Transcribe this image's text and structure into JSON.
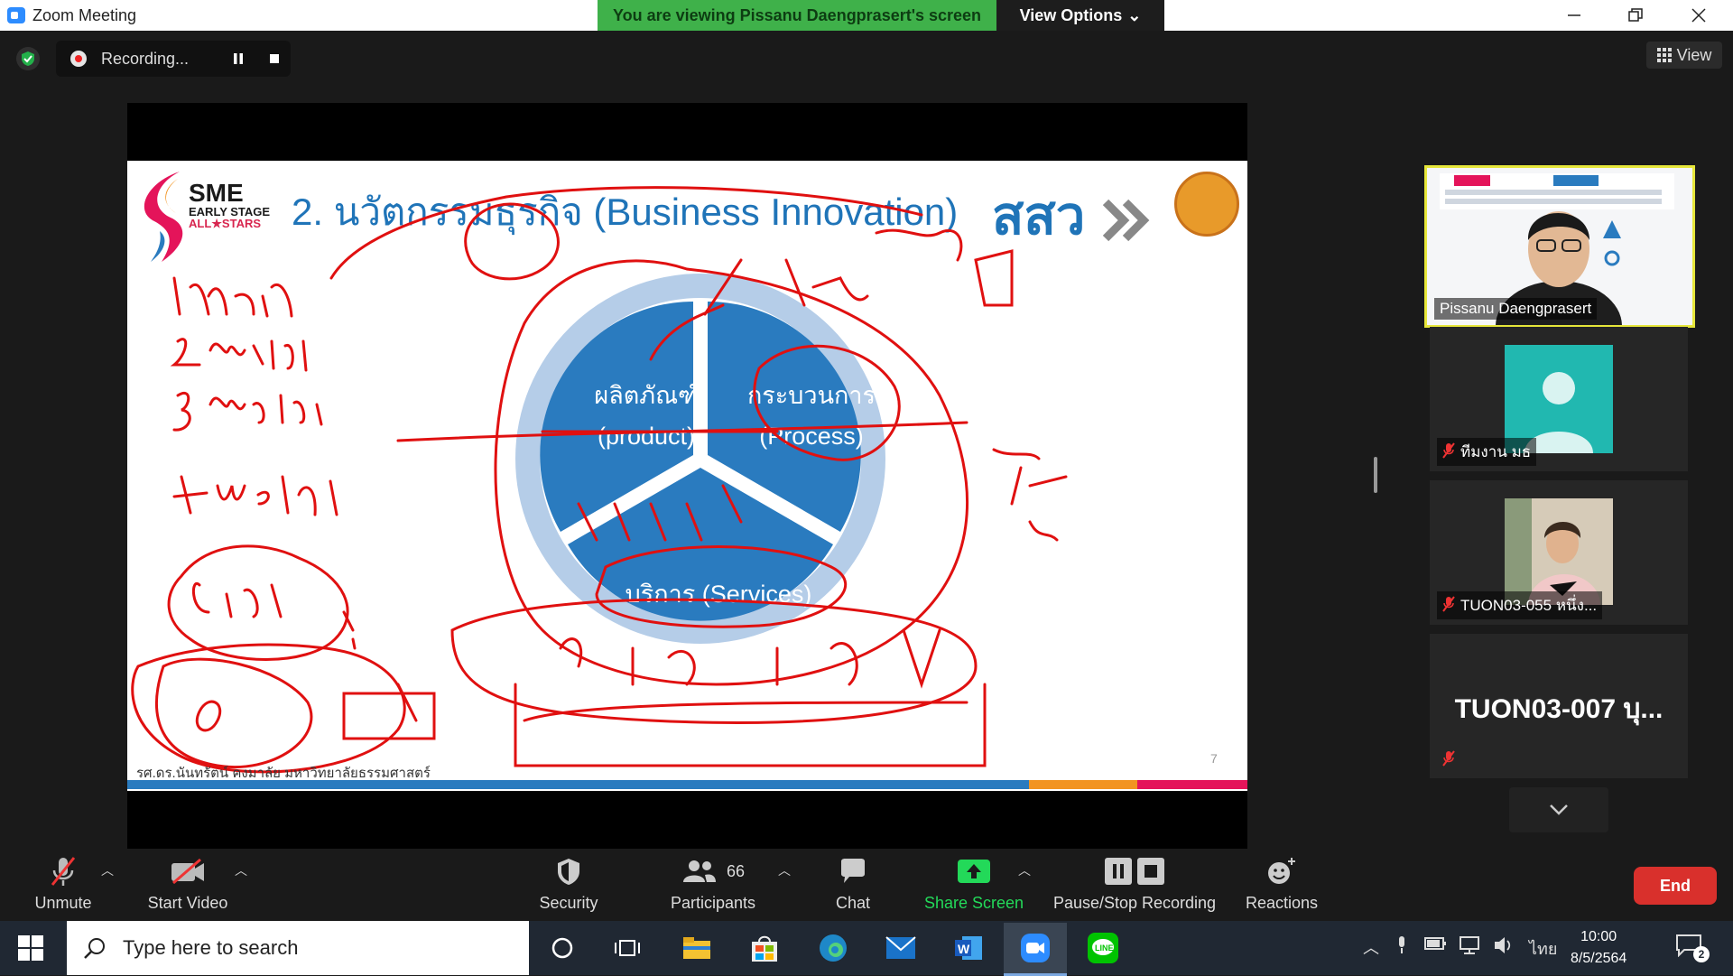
{
  "window": {
    "title": "Zoom Meeting",
    "banner": "You are viewing Pissanu Daengprasert's screen",
    "view_options": "View Options"
  },
  "recording": {
    "label": "Recording..."
  },
  "view_button": "View",
  "slide": {
    "title": "2. นวัตกรรมธุรกิจ (Business Innovation)",
    "logo_sme": "SME",
    "logo_early": "EARLY STAGE",
    "logo_stars": "ALL★STARS",
    "brand": "สสว",
    "segment_product_th": "ผลิตภัณฑ์",
    "segment_product_en": "(product)",
    "segment_process_th": "กระบวนการ",
    "segment_process_en": "(Process)",
    "segment_services": "บริการ (Services)",
    "footer": "รศ.ดร.นันทรัตน์ คงมาลัย มหาวิทยาลัยธรรมศาสตร์",
    "page_number": "7",
    "stripe_colors": [
      "#2a7bbf",
      "#f29422",
      "#e4145a"
    ]
  },
  "participants": [
    {
      "name": "Pissanu Daengprasert",
      "type": "video",
      "muted": false,
      "highlight": true
    },
    {
      "name": "ทีมงาน มธ",
      "type": "avatar",
      "muted": true
    },
    {
      "name": "TUON03-055 หนึ่ง...",
      "type": "photo",
      "muted": true
    },
    {
      "name": "TUON03-007 บุ...",
      "type": "text",
      "muted": true
    }
  ],
  "toolbar": {
    "unmute": "Unmute",
    "start_video": "Start Video",
    "security": "Security",
    "participants": "Participants",
    "participants_count": "66",
    "chat": "Chat",
    "share_screen": "Share Screen",
    "pause_stop_recording": "Pause/Stop Recording",
    "reactions": "Reactions",
    "end": "End"
  },
  "taskbar": {
    "search_placeholder": "Type here to search",
    "language": "ไทย",
    "time": "10:00",
    "date": "8/5/2564",
    "notifications": "2"
  },
  "colors": {
    "zoom_blue": "#2d8cff",
    "banner_green": "#3fb14a",
    "share_green": "#23d959",
    "end_red": "#d9302c",
    "ink_red": "#e01010"
  }
}
